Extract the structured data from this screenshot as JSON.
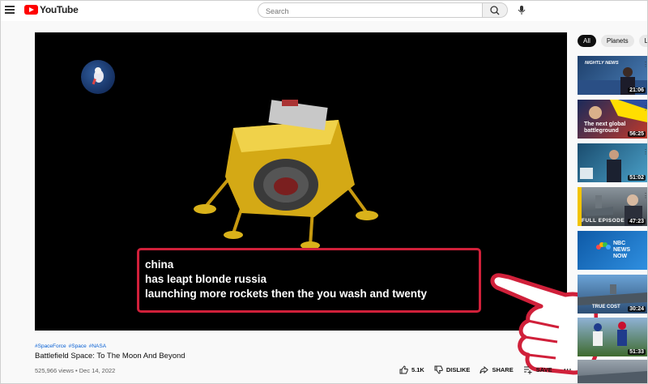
{
  "header": {
    "brand": "YouTube",
    "search_placeholder": "Search"
  },
  "player": {
    "captions": [
      "china",
      "has leapt blonde russia",
      "launching more rockets then the you wash and twenty"
    ]
  },
  "video": {
    "hashtags": [
      "#SpaceForce",
      "#Space",
      "#NASA"
    ],
    "title": "Battlefield Space: To The Moon And Beyond",
    "views_date": "525,966 views • Dec 14, 2022",
    "like_count": "5.1K",
    "dislike_label": "DISLIKE",
    "share_label": "SHARE",
    "save_label": "SAVE"
  },
  "sidebar": {
    "chips": [
      "All",
      "Planets",
      "List"
    ],
    "thumbnails": [
      {
        "duration": "21:06",
        "label": "NIGHTLY NEWS",
        "bg": "#2b5a8f"
      },
      {
        "duration": "56:25",
        "label": "The next global battleground",
        "bg": "#7a2a1e"
      },
      {
        "duration": "51:02",
        "label": "",
        "bg": "#2d6e8e"
      },
      {
        "duration": "47:23",
        "label": "FULL EPISODE",
        "bg": "#5a6570"
      },
      {
        "duration": "",
        "label": "NBC NEWS NOW",
        "bg": "#1f6fb2"
      },
      {
        "duration": "30:24",
        "label": "TRUE COST",
        "bg": "#3d5f86"
      },
      {
        "duration": "51:33",
        "label": "",
        "bg": "#4a6a3a"
      },
      {
        "duration": "",
        "label": "",
        "bg": "#6f7a84"
      }
    ]
  },
  "colors": {
    "brand_red": "#ff0000",
    "caption_border": "#d0203a",
    "link_blue": "#065fd4"
  }
}
